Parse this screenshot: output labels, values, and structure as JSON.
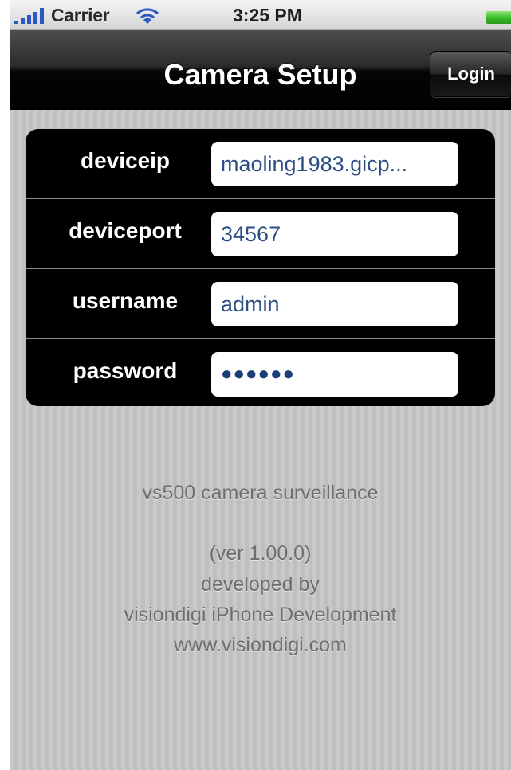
{
  "status_bar": {
    "carrier": "Carrier",
    "time": "3:25 PM",
    "signal_icon": "signal-bars-icon",
    "wifi_icon": "wifi-icon",
    "battery_icon": "battery-icon",
    "battery_color": "#35b827"
  },
  "nav": {
    "title": "Camera Setup",
    "login_label": "Login"
  },
  "form": {
    "rows": [
      {
        "label": "deviceip",
        "value": "maoling1983.gicp..."
      },
      {
        "label": "deviceport",
        "value": "34567"
      },
      {
        "label": "username",
        "value": "admin"
      },
      {
        "label": "password",
        "value": "●●●●●●"
      }
    ]
  },
  "info": {
    "app_name": "vs500 camera surveillance",
    "version": "(ver 1.00.0)",
    "developed_by": "developed by",
    "developer": "visiondigi iPhone Development",
    "website": "www.visiondigi.com"
  },
  "colors": {
    "field_text": "#2e4f86",
    "info_text": "#6e6e6e",
    "nav_bar": "#000000",
    "background": "#c8c8c8"
  }
}
